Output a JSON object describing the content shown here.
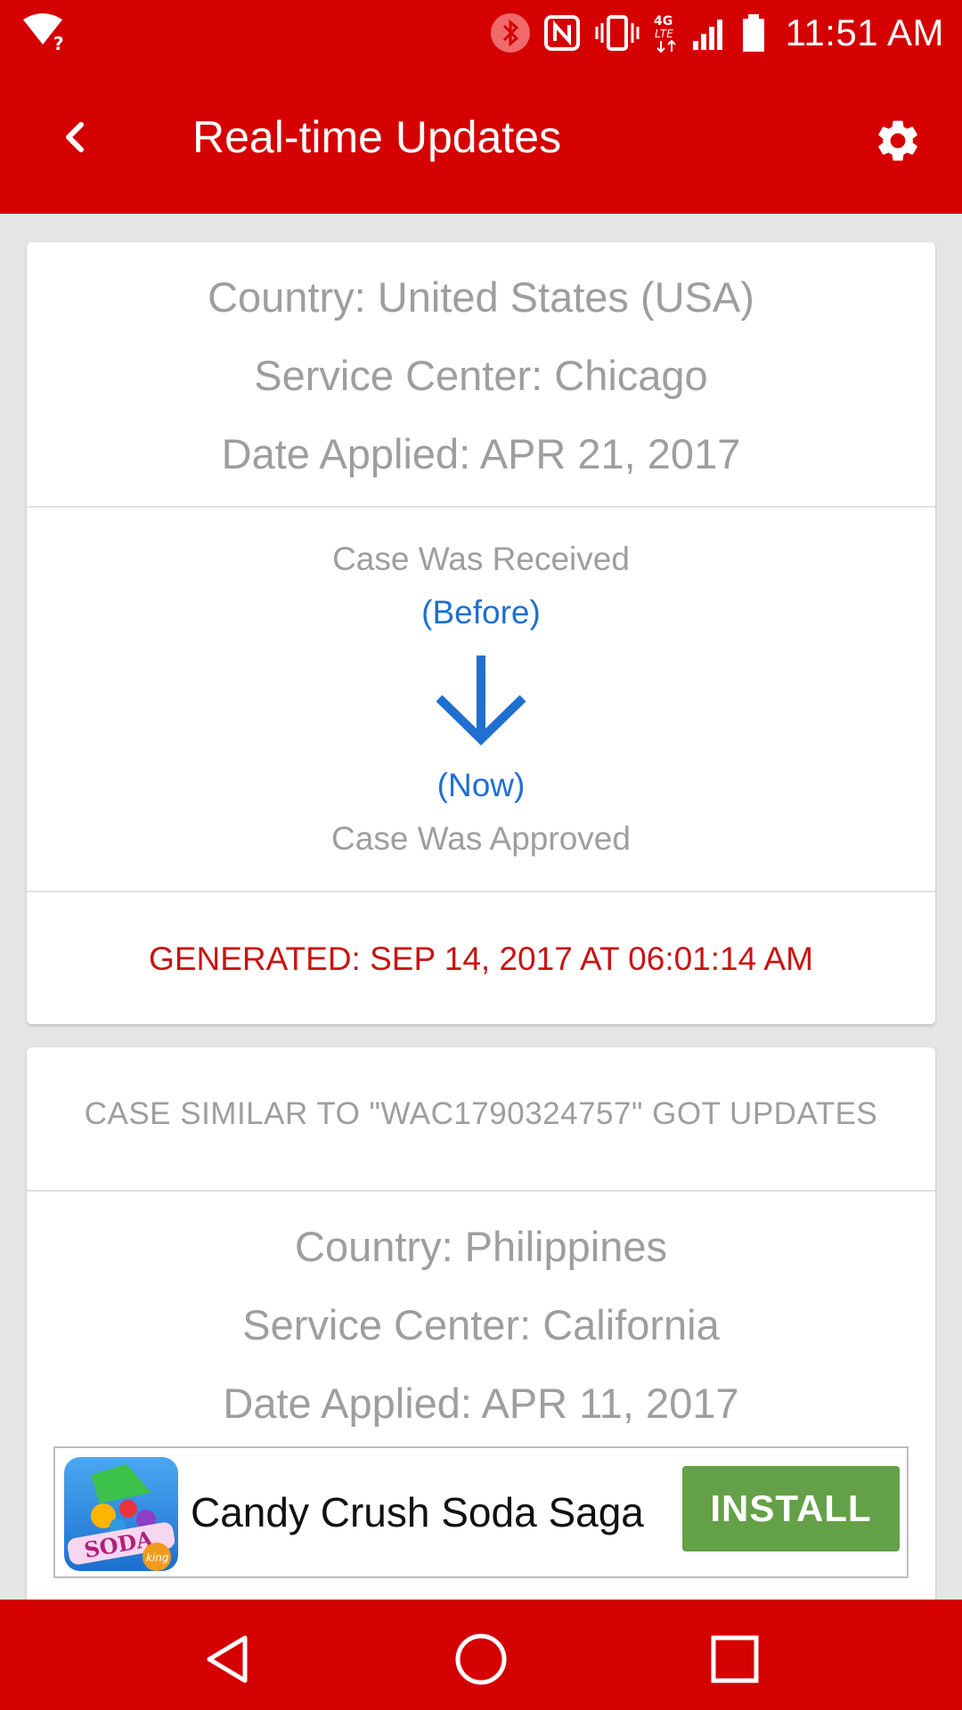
{
  "status_bar": {
    "time": "11:51 AM",
    "network_label": "4G LTE",
    "icons": [
      "wifi-question-icon",
      "bluetooth-icon",
      "nfc-icon",
      "vibrate-icon",
      "lte-icon",
      "signal-icon",
      "battery-icon"
    ]
  },
  "app_bar": {
    "title": "Real-time Updates",
    "back_icon": "chevron-left-icon",
    "settings_icon": "gear-icon"
  },
  "cards": [
    {
      "country": "Country: United States (USA)",
      "service_center": "Service Center: Chicago",
      "date_applied": "Date Applied: APR 21, 2017",
      "before_status": "Case Was Received",
      "before_tag": "(Before)",
      "now_tag": "(Now)",
      "now_status": "Case Was Approved",
      "generated": "GENERATED: SEP 14, 2017 AT 06:01:14 AM"
    },
    {
      "headline": "CASE SIMILAR TO \"WAC1790324757\" GOT UPDATES",
      "country": "Country: Philippines",
      "service_center": "Service Center: California",
      "date_applied": "Date Applied: APR 11, 2017"
    }
  ],
  "ad": {
    "title": "Candy Crush Soda Saga",
    "install_label": "INSTALL",
    "icon_text": "SODA",
    "icon_sub": "king"
  },
  "nav_bar": {
    "icons": [
      "back-triangle-icon",
      "home-circle-icon",
      "recents-square-icon"
    ]
  },
  "colors": {
    "primary": "#d50000",
    "accent_blue": "#1f6fd1",
    "generated_red": "#c81414",
    "install_green": "#64a047",
    "muted_text": "#9e9e9e"
  }
}
